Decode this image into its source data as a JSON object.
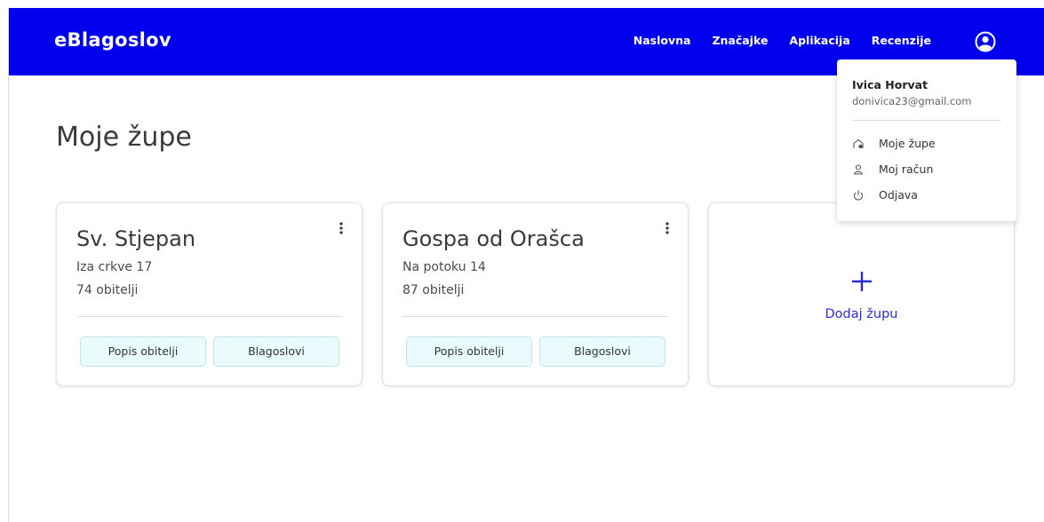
{
  "header": {
    "brand": "eBlagoslov",
    "nav": [
      "Naslovna",
      "Značajke",
      "Aplikacija",
      "Recenzije"
    ]
  },
  "main": {
    "title": "Moje župe",
    "parishes": [
      {
        "name": "Sv. Stjepan",
        "address": "Iza crkve 17",
        "families": "74 obitelji",
        "actions": [
          "Popis obitelji",
          "Blagoslovi"
        ]
      },
      {
        "name": "Gospa od Orašca",
        "address": "Na potoku 14",
        "families": "87 obitelji",
        "actions": [
          "Popis obitelji",
          "Blagoslovi"
        ]
      }
    ],
    "add_parish": {
      "icon": "plus-icon",
      "label": "Dodaj župu"
    }
  },
  "account_menu": {
    "icon": "account-circle-icon",
    "user_name": "Ivica Horvat",
    "email": "donivica23@gmail.com",
    "items": [
      {
        "icon": "church-icon",
        "label": "Moje župe"
      },
      {
        "icon": "user-icon",
        "label": "Moj račun"
      },
      {
        "icon": "power-icon",
        "label": "Odjava"
      }
    ]
  },
  "colors": {
    "brand_blue": "#0000ee",
    "accent_blue": "#2a2ae0",
    "button_bg": "#e9fbfd"
  }
}
